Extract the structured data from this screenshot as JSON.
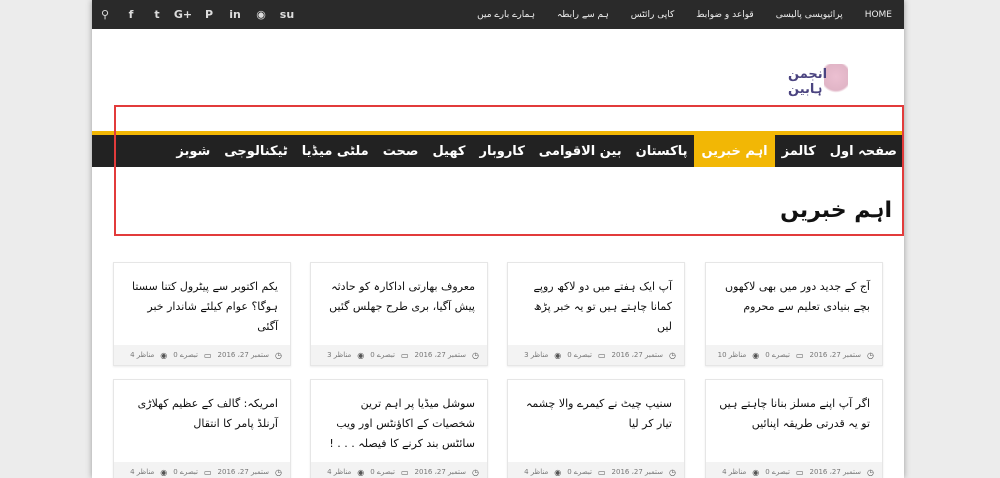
{
  "topbar": {
    "social_icons": [
      "search-icon",
      "facebook-icon",
      "twitter-icon",
      "google-plus-icon",
      "pinterest-icon",
      "linkedin-icon",
      "reddit-icon",
      "stumbleupon-icon"
    ],
    "social_glyphs": [
      "⚲",
      "f",
      "t",
      "G+",
      "P",
      "in",
      "◉",
      "su"
    ],
    "menu": [
      "HOME",
      "پرائیویسی پالیسی",
      "قواعد و ضوابط",
      "کاپی رائٹس",
      "ہم سے رابطہ",
      "ہمارے بارے میں"
    ]
  },
  "logo": {
    "text": "انجمن ہابین"
  },
  "nav": {
    "items": [
      "صفحہ اول",
      "کالمز",
      "اہم خبریں",
      "پاکستان",
      "بین الاقوامی",
      "کاروبار",
      "کھیل",
      "صحت",
      "ملٹی میڈیا",
      "ٹیکنالوجی",
      "شوبز"
    ],
    "active_index": 2
  },
  "section": {
    "title": "اہم خبریں"
  },
  "cards": [
    {
      "title": "آج کے جدید دور میں بھی لاکھوں بچے بنیادی تعلیم سے محروم",
      "date": "ستمبر 27، 2016",
      "comments": "0 تبصرے",
      "views": "10 مناظر"
    },
    {
      "title": "آپ ایک ہفتے میں دو لاکھ روپے کمانا چاہتے ہیں تو یہ خبر پڑھ لیں",
      "date": "ستمبر 27، 2016",
      "comments": "0 تبصرے",
      "views": "3 مناظر"
    },
    {
      "title": "معروف بھارتی اداکارہ کو حادثہ پیش آگیا، بری طرح جھلس گئیں",
      "date": "ستمبر 27، 2016",
      "comments": "0 تبصرے",
      "views": "3 مناظر"
    },
    {
      "title": "یکم اکتوبر سے پیٹرول کتنا سستا ہوگا؟ عوام کیلئے شاندار خبر آگئی",
      "date": "ستمبر 27، 2016",
      "comments": "0 تبصرے",
      "views": "4 مناظر"
    },
    {
      "title": "اگر آپ اپنے مسلز بنانا چاہتے ہیں تو یہ قدرتی طریقہ اپنائیں",
      "date": "ستمبر 27، 2016",
      "comments": "0 تبصرے",
      "views": "4 مناظر"
    },
    {
      "title": "سنیپ چیٹ نے کیمرے والا چشمہ تیار کر لیا",
      "date": "ستمبر 27، 2016",
      "comments": "0 تبصرے",
      "views": "4 مناظر"
    },
    {
      "title": "سوشل میڈیا پر اہم ترین شخصیات کے اکاؤنٹس اور ویب سائٹس بند کرنے کا فیصلہ . . . !",
      "date": "ستمبر 27، 2016",
      "comments": "0 تبصرے",
      "views": "4 مناظر"
    },
    {
      "title": "امریکہ: گالف کے عظیم کھلاڑی آرنلڈ پامر کا انتقال",
      "date": "ستمبر 27، 2016",
      "comments": "0 تبصرے",
      "views": "4 مناظر"
    }
  ]
}
